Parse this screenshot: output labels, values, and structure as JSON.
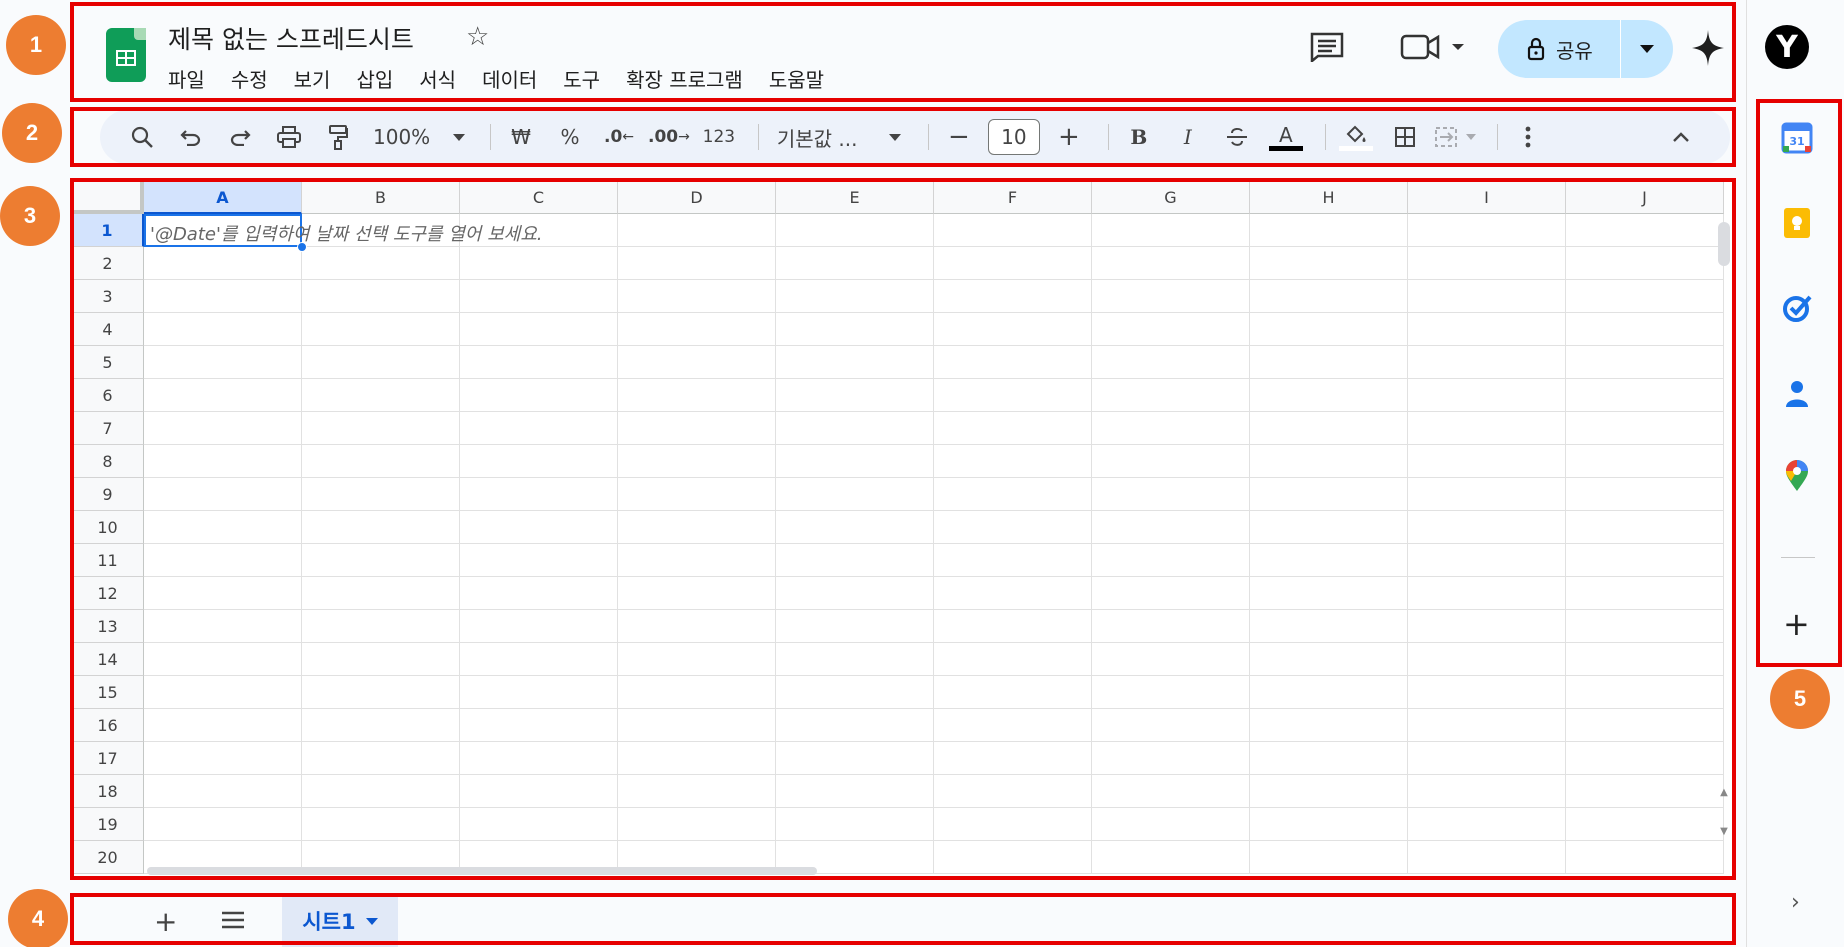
{
  "header": {
    "title": "제목 없는 스프레드시트",
    "menu": [
      "파일",
      "수정",
      "보기",
      "삽입",
      "서식",
      "데이터",
      "도구",
      "확장 프로그램",
      "도움말"
    ],
    "share_label": "공유",
    "avatar_letter": "Y"
  },
  "toolbar": {
    "zoom": "100%",
    "currency": "₩",
    "percent": "%",
    "decrease_decimal": ".0",
    "increase_decimal": ".00",
    "number_format": "123",
    "font": "기본값 ...",
    "font_size": "10",
    "bold": "B",
    "italic": "I",
    "text_color_letter": "A"
  },
  "grid": {
    "columns": [
      "A",
      "B",
      "C",
      "D",
      "E",
      "F",
      "G",
      "H",
      "I",
      "J"
    ],
    "rows": [
      "1",
      "2",
      "3",
      "4",
      "5",
      "6",
      "7",
      "8",
      "9",
      "10",
      "11",
      "12",
      "13",
      "14",
      "15",
      "16",
      "17",
      "18",
      "19",
      "20"
    ],
    "selected_cell": "A1",
    "hint": "'@Date'를 입력하여 날짜 선택 도구를 열어 보세요."
  },
  "sheets": {
    "tabs": [
      "시트1"
    ]
  },
  "annotations": [
    "1",
    "2",
    "3",
    "4",
    "5"
  ],
  "colors": {
    "annotation_box": "#e60000",
    "annotation_circle": "#ed7d31",
    "sheets_green": "#0f9d58",
    "selection_blue": "#1a73e8",
    "share_bg": "#c2e7ff"
  }
}
